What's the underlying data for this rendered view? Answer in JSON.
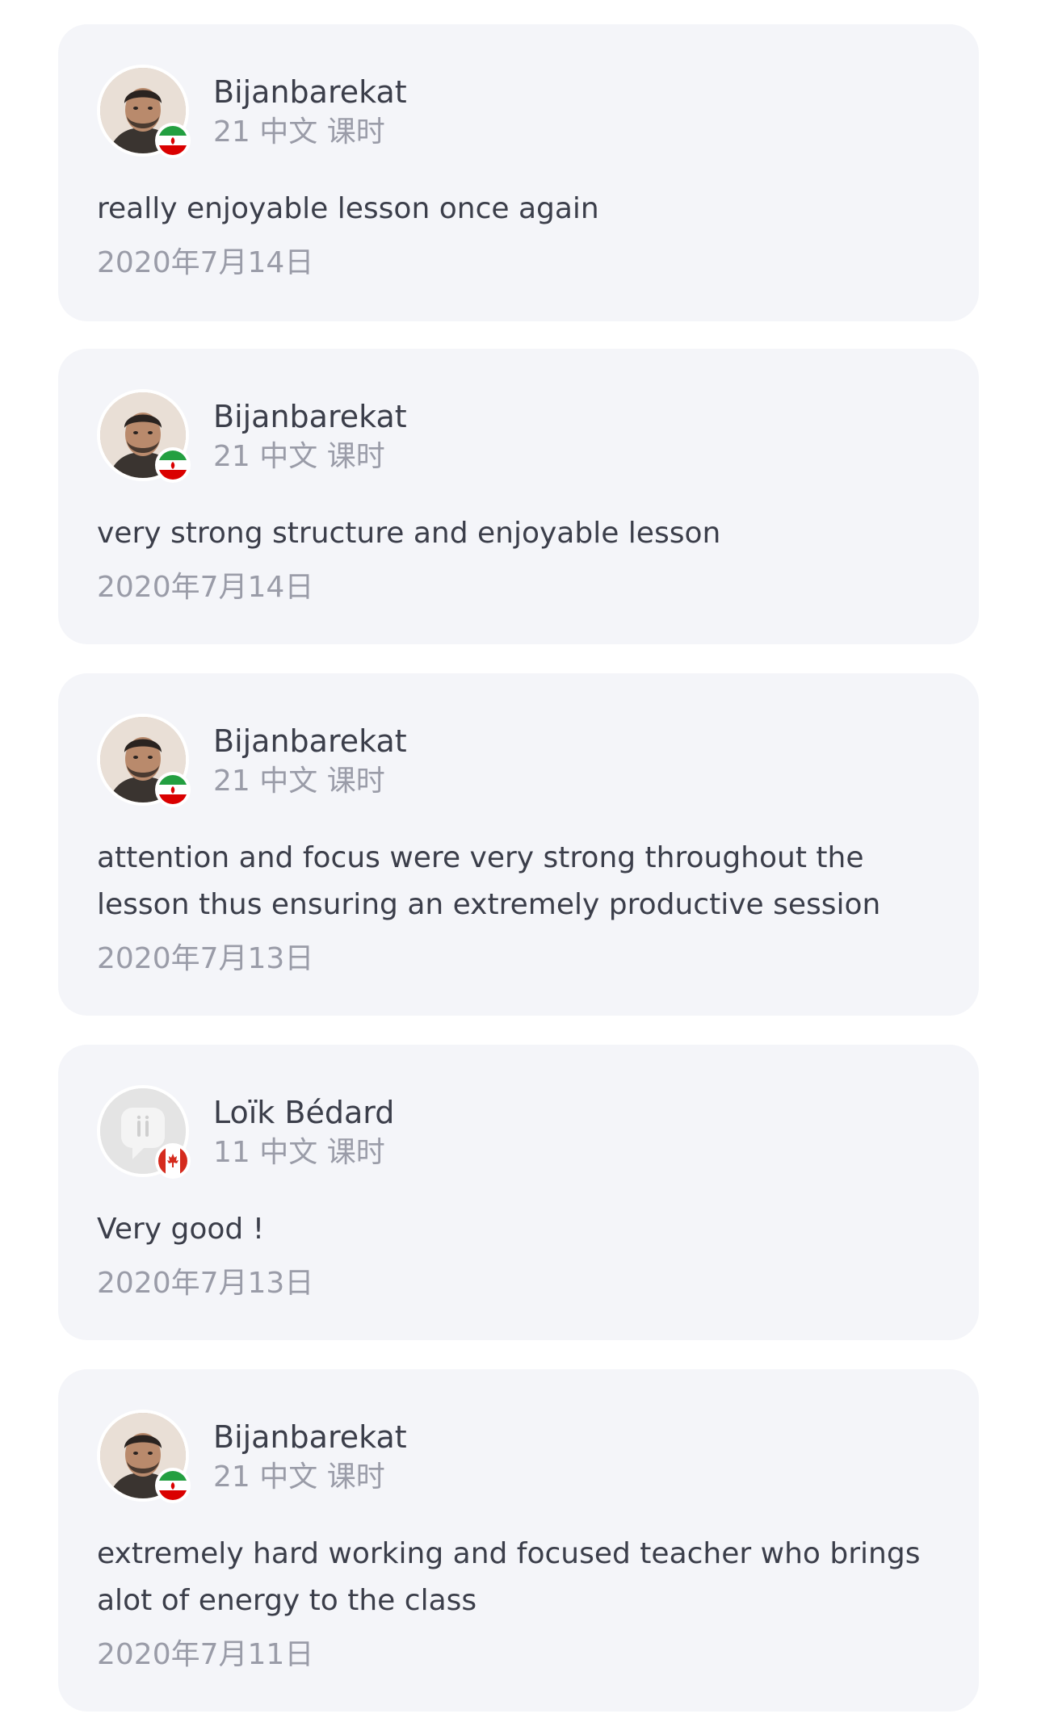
{
  "reviews": [
    {
      "name": "Bijanbarekat",
      "lessons": "21 中文 课时",
      "text": "really enjoyable lesson once again",
      "date": "2020年7月14日",
      "avatar": "photo-avatar",
      "flag": "iran-flag-icon"
    },
    {
      "name": "Bijanbarekat",
      "lessons": "21 中文 课时",
      "text": "very strong structure and enjoyable lesson",
      "date": "2020年7月14日",
      "avatar": "photo-avatar",
      "flag": "iran-flag-icon"
    },
    {
      "name": "Bijanbarekat",
      "lessons": "21 中文 课时",
      "text": "attention and focus were very strong throughout the lesson thus ensuring an extremely productive session",
      "date": "2020年7月13日",
      "avatar": "photo-avatar",
      "flag": "iran-flag-icon"
    },
    {
      "name": "Loïk Bédard",
      "lessons": "11 中文 课时",
      "text": "Very good !",
      "date": "2020年7月13日",
      "avatar": "default-avatar-icon",
      "flag": "canada-flag-icon"
    },
    {
      "name": "Bijanbarekat",
      "lessons": "21 中文 课时",
      "text": "extremely hard working and focused teacher who brings alot of energy to the class",
      "date": "2020年7月11日",
      "avatar": "photo-avatar",
      "flag": "iran-flag-icon"
    }
  ],
  "colors": {
    "card_background": "#f4f5f9",
    "primary_text": "#3b3e4a",
    "secondary_text": "#9a9ca8"
  }
}
